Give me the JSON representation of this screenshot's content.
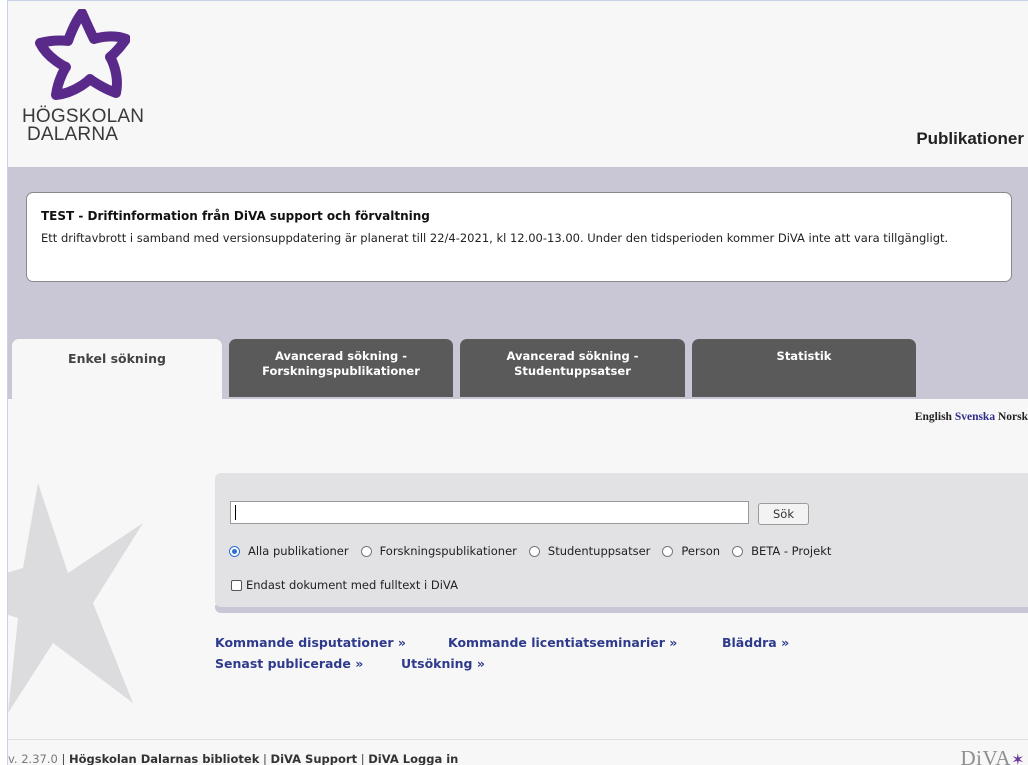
{
  "header": {
    "logo_line1": "HÖGSKOLAN",
    "logo_line2": "DALARNA",
    "title": "Publikationer"
  },
  "notice": {
    "title": "TEST - Driftinformation från DiVA support och förvaltning",
    "text": "Ett driftavbrott i samband med versionsuppdatering är planerat till 22/4-2021, kl 12.00-13.00. Under den tidsperioden kommer DiVA inte att vara tillgängligt."
  },
  "tabs": [
    {
      "label": "Enkel sökning",
      "active": true
    },
    {
      "label_line1": "Avancerad sökning -",
      "label_line2": "Forskningspublikationer",
      "active": false
    },
    {
      "label_line1": "Avancerad sökning -",
      "label_line2": "Studentuppsatser",
      "active": false
    },
    {
      "label": "Statistik",
      "active": false
    }
  ],
  "languages": {
    "english": "English",
    "svenska": "Svenska",
    "norsk": "Norsk",
    "selected": "Svenska"
  },
  "search": {
    "value": "",
    "button_label": "Sök",
    "radio_options": [
      "Alla publikationer",
      "Forskningspublikationer",
      "Studentuppsatser",
      "Person",
      "BETA - Projekt"
    ],
    "selected_option": "Alla publikationer",
    "checkbox_label": "Endast dokument med fulltext i DiVA",
    "checkbox_checked": false
  },
  "links": {
    "upcoming_disputations": "Kommande disputationer »",
    "upcoming_licentiate": "Kommande licentiatseminarier »",
    "browse": "Bläddra »",
    "recently_published": "Senast publicerade »",
    "extraction": "Utsökning »"
  },
  "footer": {
    "version": "v. 2.37.0",
    "separator": "|",
    "library": "Högskolan Dalarnas bibliotek",
    "support": "DiVA Support",
    "login": "DiVA Logga in",
    "brand": "DiVA"
  },
  "colors": {
    "band": "#c9c7d6",
    "tab_inactive": "#5a5a5a",
    "link": "#2e3a8c",
    "logo_purple": "#5a2a8a"
  }
}
